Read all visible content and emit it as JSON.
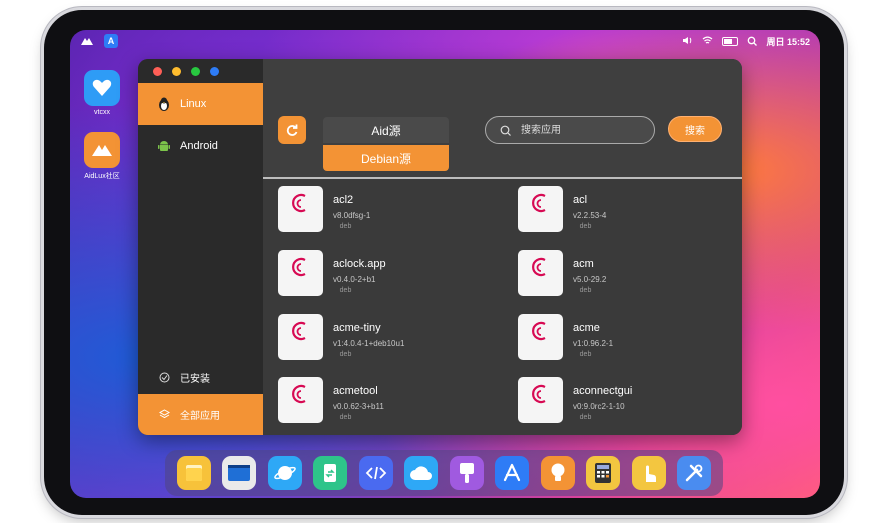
{
  "status_bar": {
    "clock": "周日 15:52",
    "launcher_app_letter": "A"
  },
  "desktop": {
    "icons": [
      {
        "label": "vtcxx",
        "color": "#2e9cf6",
        "icon": "heart-icon"
      },
      {
        "label": "AidLux社区",
        "color": "#f39335",
        "icon": "aidlux-logo-icon"
      }
    ]
  },
  "window": {
    "dot_colors": [
      "#ff5f57",
      "#febc2e",
      "#28c840",
      "#2e7cf6"
    ],
    "sidebar": {
      "items": [
        {
          "label": "Linux",
          "icon": "penguin-icon",
          "active": true
        },
        {
          "label": "Android",
          "icon": "android-icon",
          "active": false
        }
      ],
      "installed": {
        "label": "已安装",
        "icon": "check-circle-icon"
      },
      "all_apps": {
        "label": "全部应用",
        "icon": "layers-icon"
      }
    },
    "header": {
      "source_tabs": [
        {
          "label": "Aid源",
          "active": false
        },
        {
          "label": "Debian源",
          "active": true
        }
      ],
      "search_placeholder": "搜索应用",
      "search_button": "搜索"
    },
    "packages": [
      {
        "name": "acl2",
        "version": "v8.0dfsg-1",
        "badge": "deb"
      },
      {
        "name": "acl",
        "version": "v2.2.53-4",
        "badge": "deb"
      },
      {
        "name": "aclock.app",
        "version": "v0.4.0-2+b1",
        "badge": "deb"
      },
      {
        "name": "acm",
        "version": "v5.0-29.2",
        "badge": "deb"
      },
      {
        "name": "acme-tiny",
        "version": "v1:4.0.4-1+deb10u1",
        "badge": "deb"
      },
      {
        "name": "acme",
        "version": "v1:0.96.2-1",
        "badge": "deb"
      },
      {
        "name": "acmetool",
        "version": "v0.0.62-3+b11",
        "badge": "deb"
      },
      {
        "name": "aconnectgui",
        "version": "v0:9.0rc2-1-10",
        "badge": "deb"
      }
    ]
  },
  "dock": {
    "apps": [
      {
        "name": "files",
        "color": "#f7c23a",
        "icon": "folder-icon"
      },
      {
        "name": "terminal",
        "color": "#1f6fd6",
        "icon": "terminal-icon"
      },
      {
        "name": "browser",
        "color": "#2ea8f6",
        "icon": "planet-icon"
      },
      {
        "name": "file-transfer",
        "color": "#2ec48a",
        "icon": "transfer-icon"
      },
      {
        "name": "code-editor",
        "color": "#4a6af0",
        "icon": "code-icon"
      },
      {
        "name": "cloud",
        "color": "#2ea8f6",
        "icon": "cloud-icon"
      },
      {
        "name": "paint",
        "color": "#a05ae0",
        "icon": "brush-icon"
      },
      {
        "name": "app-store",
        "color": "#2e7cf6",
        "icon": "appstore-icon"
      },
      {
        "name": "tips",
        "color": "#f39335",
        "icon": "bulb-icon"
      },
      {
        "name": "calculator",
        "color": "#f3c640",
        "icon": "calculator-icon"
      },
      {
        "name": "touch",
        "color": "#f3c640",
        "icon": "hand-icon"
      },
      {
        "name": "tools",
        "color": "#4a8cf0",
        "icon": "tools-icon"
      }
    ]
  }
}
